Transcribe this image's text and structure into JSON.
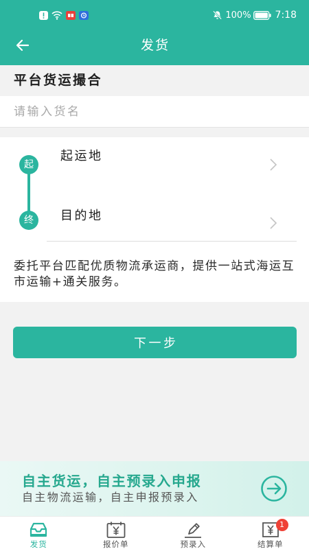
{
  "colors": {
    "primary": "#2bb59f",
    "background": "#f2f2f2",
    "badge": "#ef4136",
    "inactive": "#555555",
    "banner_title": "#26a88e"
  },
  "status_bar": {
    "left_icons": [
      "alert-notification-icon",
      "wifi-icon",
      "red-app-notification-icon",
      "blue-app-notification-icon"
    ],
    "mute_icon": "bell-off-icon",
    "battery_percent": "100%",
    "battery_icon": "battery-icon",
    "time": "7:18"
  },
  "header": {
    "back_icon": "back-arrow-icon",
    "title": "发货"
  },
  "form": {
    "section_label": "平台货运撮合",
    "cargo_name": {
      "value": "",
      "placeholder": "请输入货名"
    }
  },
  "route": {
    "origin": {
      "badge": "起",
      "label": "起运地",
      "icon": "chevron-right-icon"
    },
    "destination": {
      "badge": "终",
      "label": "目的地",
      "icon": "chevron-right-icon"
    },
    "description": "委托平台匹配优质物流承运商，提供一站式海运互市运输+通关服务。"
  },
  "next_button": {
    "label": "下一步"
  },
  "promo_banner": {
    "title": "自主货运，自主预录入申报",
    "subtitle": "自主物流运输，自主申报预录入",
    "icon": "arrow-right-circle-icon"
  },
  "tabs": [
    {
      "label": "发货",
      "icon": "inbox-icon",
      "active": true
    },
    {
      "label": "报价单",
      "icon": "quote-calendar-icon",
      "active": false
    },
    {
      "label": "预录入",
      "icon": "pen-icon",
      "active": false
    },
    {
      "label": "结算单",
      "icon": "settlement-doc-icon",
      "active": false,
      "badge": "1"
    }
  ]
}
